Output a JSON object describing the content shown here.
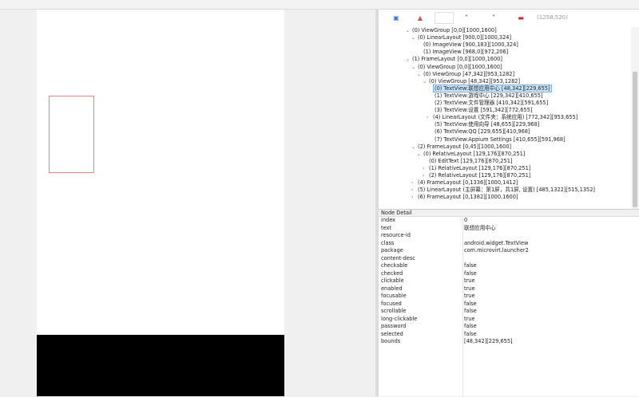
{
  "toolbar": {
    "coords": "(1258,520)"
  },
  "tree": [
    {
      "text": "(0) ViewGroup [0,0][1000,1600]",
      "depth": 0,
      "toggle": "⌄"
    },
    {
      "text": "(0) LinearLayout [900,0][1000,324]",
      "depth": 1,
      "toggle": "⌄"
    },
    {
      "text": "(0) ImageView [900,183][1000,324]",
      "depth": 2,
      "toggle": ""
    },
    {
      "text": "(1) ImageView [968,0][972,206]",
      "depth": 2,
      "toggle": ""
    },
    {
      "text": "(1) FrameLayout [0,0][1000,1600]",
      "depth": 0,
      "toggle": "⌄"
    },
    {
      "text": "(0) ViewGroup [0,0][1000,1600]",
      "depth": 1,
      "toggle": "⌄"
    },
    {
      "text": "(0) ViewGroup [47,342][953,1282]",
      "depth": 2,
      "toggle": "⌄"
    },
    {
      "text": "(0) ViewGroup [48,342][953,1282]",
      "depth": 3,
      "toggle": "⌄"
    },
    {
      "text": "(0) TextView:联想应用中心 [48,342][229,655]",
      "depth": 4,
      "toggle": "",
      "selected": true
    },
    {
      "text": "(1) TextView:游戏中心 [229,342][410,655]",
      "depth": 4,
      "toggle": ""
    },
    {
      "text": "(2) TextView:文件管理器 [410,342][591,655]",
      "depth": 4,
      "toggle": ""
    },
    {
      "text": "(3) TextView:设置 [591,342][772,655]",
      "depth": 4,
      "toggle": ""
    },
    {
      "text": "(4) LinearLayout (文件夹：系统应用) [772,342][953,655]",
      "depth": 3,
      "toggle": "›",
      "indentFix": true
    },
    {
      "text": "(5) TextView:使用向导 [48,655][229,968]",
      "depth": 4,
      "toggle": ""
    },
    {
      "text": "(6) TextView:QQ [229,655][410,968]",
      "depth": 4,
      "toggle": ""
    },
    {
      "text": "(7) TextView:Appium Settings [410,655][591,968]",
      "depth": 4,
      "toggle": ""
    },
    {
      "text": "(2) FrameLayout [0,45][1000,1600]",
      "depth": 1,
      "toggle": "⌄"
    },
    {
      "text": "(0) RelativeLayout [129,176][870,251]",
      "depth": 2,
      "toggle": "⌄"
    },
    {
      "text": "(0) EditText [129,176][870,251]",
      "depth": 3,
      "toggle": ""
    },
    {
      "text": "(1) RelativeLayout [129,176][870,251]",
      "depth": 3,
      "toggle": "›"
    },
    {
      "text": "(2) RelativeLayout [129,176][870,251]",
      "depth": 3,
      "toggle": "›"
    },
    {
      "text": "(4) FrameLayout [0,1336][1000,1412]",
      "depth": 1,
      "toggle": "›"
    },
    {
      "text": "(5) LinearLayout (主屏幕：第1屏，共1屏, 设置) [485,1322][515,1352]",
      "depth": 1,
      "toggle": "›"
    },
    {
      "text": "(6) FrameLayout [0,1382][1000,1600]",
      "depth": 1,
      "toggle": "›"
    }
  ],
  "detail": {
    "title": "Node Detail",
    "rows": [
      {
        "k": "index",
        "v": "0"
      },
      {
        "k": "text",
        "v": "联想应用中心"
      },
      {
        "k": "resource-id",
        "v": ""
      },
      {
        "k": "class",
        "v": "android.widget.TextView"
      },
      {
        "k": "package",
        "v": "com.microvirt.launcher2"
      },
      {
        "k": "content-desc",
        "v": ""
      },
      {
        "k": "checkable",
        "v": "false"
      },
      {
        "k": "checked",
        "v": "false"
      },
      {
        "k": "clickable",
        "v": "true"
      },
      {
        "k": "enabled",
        "v": "true"
      },
      {
        "k": "focusable",
        "v": "true"
      },
      {
        "k": "focused",
        "v": "false"
      },
      {
        "k": "scrollable",
        "v": "false"
      },
      {
        "k": "long-clickable",
        "v": "true"
      },
      {
        "k": "password",
        "v": "false"
      },
      {
        "k": "selected",
        "v": "false"
      },
      {
        "k": "bounds",
        "v": "[48,342][229,655]"
      }
    ]
  }
}
